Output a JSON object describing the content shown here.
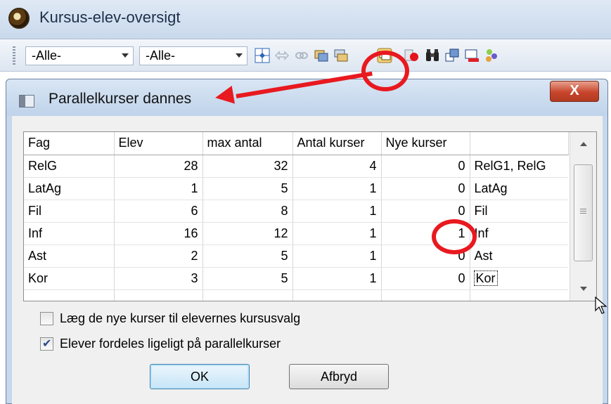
{
  "app": {
    "title": "Kursus-elev-oversigt"
  },
  "toolbar": {
    "filter1": "-Alle-",
    "filter2": "-Alle-",
    "icons": [
      "column-layout-icon",
      "arrows-icon",
      "chain-icon",
      "copy-course-icon",
      "parallel-courses-icon",
      "course-dot-icon",
      "binoculars-icon",
      "windows-icon",
      "remove-course-icon",
      "people-icon"
    ]
  },
  "dialog": {
    "title": "Parallelkurser dannes",
    "close_label": "X",
    "table": {
      "columns": [
        "Fag",
        "Elev",
        "max antal",
        "Antal kurser",
        "Nye kurser",
        ""
      ],
      "rows": [
        [
          "RelG",
          "28",
          "32",
          "4",
          "0",
          "RelG1, RelG"
        ],
        [
          "LatAg",
          "1",
          "5",
          "1",
          "0",
          "LatAg"
        ],
        [
          "Fil",
          "6",
          "8",
          "1",
          "0",
          "Fil"
        ],
        [
          "Inf",
          "16",
          "12",
          "1",
          "1",
          "Inf"
        ],
        [
          "Ast",
          "2",
          "5",
          "1",
          "0",
          "Ast"
        ],
        [
          "Kor",
          "3",
          "5",
          "1",
          "0",
          "Kor"
        ]
      ]
    },
    "checkbox1": {
      "label": "Læg de nye kurser til elevernes kursusvalg",
      "checked": false
    },
    "checkbox2": {
      "label": "Elever fordeles ligeligt på parallelkurser",
      "checked": true
    },
    "ok_label": "OK",
    "cancel_label": "Afbryd"
  },
  "colors": {
    "annotation": "#e8191f",
    "title_bar": "#c9d9ec",
    "dialog_body": "#f0f0f0"
  }
}
